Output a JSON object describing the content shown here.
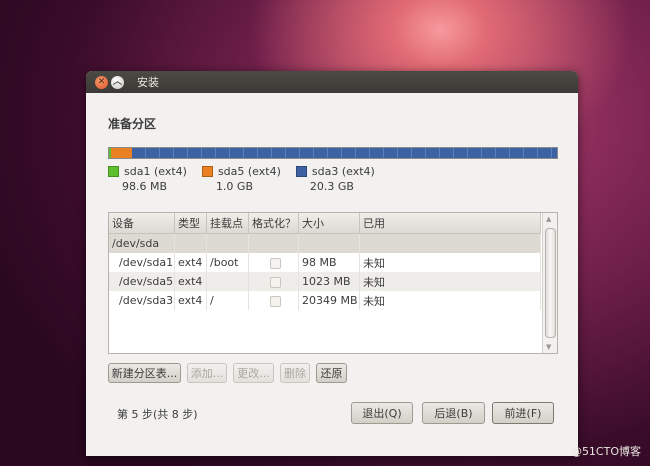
{
  "window": {
    "title": "安装"
  },
  "titlebar_icons": {
    "close": "close-icon",
    "minimize": "chevron-up-icon"
  },
  "heading": "准备分区",
  "colors": {
    "sda1": "#5ec02c",
    "sda5": "#e98023",
    "sda3": "#3d62a3"
  },
  "legend": [
    {
      "label": "sda1 (ext4)",
      "size": "98.6 MB"
    },
    {
      "label": "sda5 (ext4)",
      "size": "1.0 GB"
    },
    {
      "label": "sda3 (ext4)",
      "size": "20.3 GB"
    }
  ],
  "table": {
    "headers": [
      "设备",
      "类型",
      "挂载点",
      "格式化？",
      "大小",
      "已用"
    ],
    "disk": "/dev/sda",
    "rows": [
      {
        "device": "/dev/sda1",
        "type": "ext4",
        "mount": "/boot",
        "size": "98 MB",
        "used": "未知"
      },
      {
        "device": "/dev/sda5",
        "type": "ext4",
        "mount": "",
        "size": "1023 MB",
        "used": "未知"
      },
      {
        "device": "/dev/sda3",
        "type": "ext4",
        "mount": "/",
        "size": "20349 MB",
        "used": "未知"
      }
    ]
  },
  "actions": {
    "new_table": "新建分区表...",
    "add": "添加...",
    "change": "更改...",
    "delete": "删除",
    "revert": "还原"
  },
  "step_text": "第 5 步(共 8 步)",
  "nav": {
    "quit": "退出(Q)",
    "back": "后退(B)",
    "forward": "前进(F)"
  },
  "watermark": "@51CTO博客"
}
